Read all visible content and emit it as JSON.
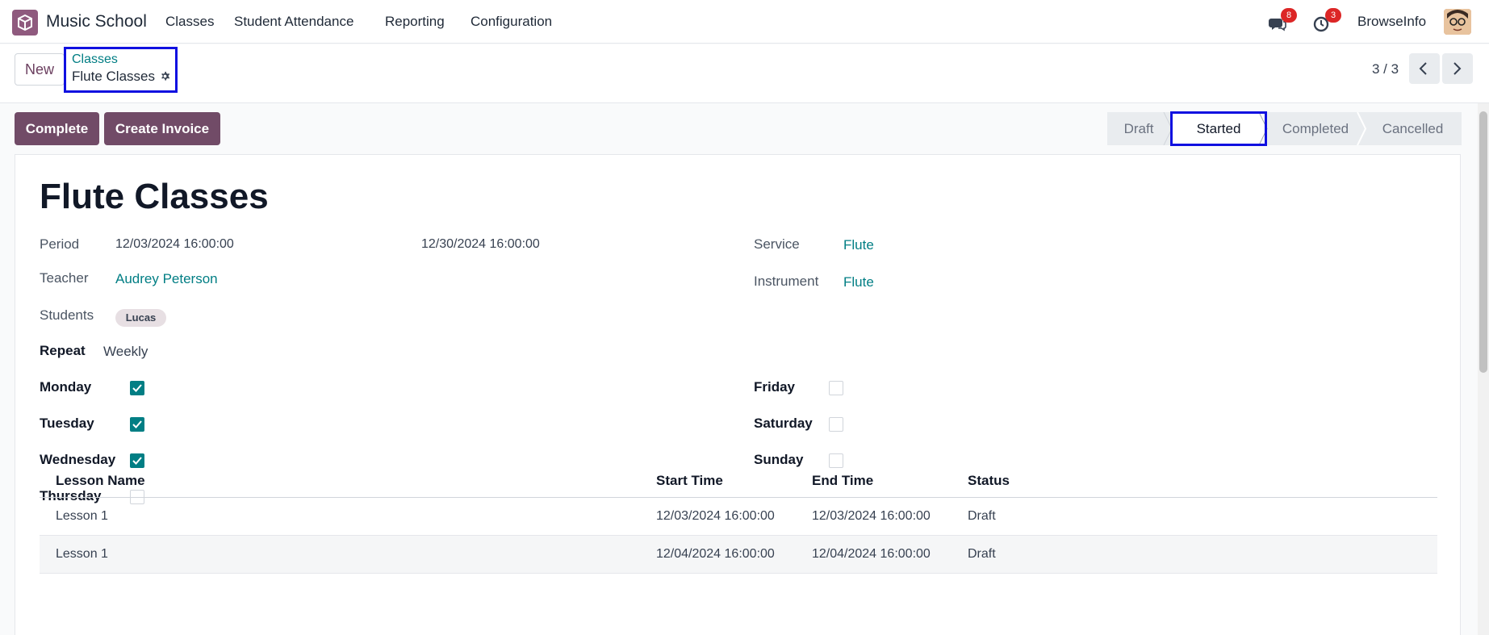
{
  "navbar": {
    "app_name": "Music School",
    "menu": [
      "Classes",
      "Student Attendance",
      "Reporting",
      "Configuration"
    ],
    "messages_count": "8",
    "activities_count": "3",
    "company": "BrowseInfo"
  },
  "control": {
    "new_label": "New",
    "breadcrumb_parent": "Classes",
    "breadcrumb_current": "Flute Classes",
    "pager": "3 / 3"
  },
  "actions": {
    "complete": "Complete",
    "create_invoice": "Create Invoice"
  },
  "status": {
    "stages": [
      "Draft",
      "Started",
      "Completed",
      "Cancelled"
    ],
    "active": "Started"
  },
  "record": {
    "title": "Flute Classes",
    "period_label": "Period",
    "period_start": "12/03/2024 16:00:00",
    "period_end": "12/30/2024 16:00:00",
    "teacher_label": "Teacher",
    "teacher": "Audrey Peterson",
    "students_label": "Students",
    "student_tag": "Lucas",
    "service_label": "Service",
    "service": "Flute",
    "instrument_label": "Instrument",
    "instrument": "Flute",
    "repeat_label": "Repeat",
    "repeat": "Weekly"
  },
  "days": {
    "monday": "Monday",
    "tuesday": "Tuesday",
    "wednesday": "Wednesday",
    "thursday": "Thursday",
    "friday": "Friday",
    "saturday": "Saturday",
    "sunday": "Sunday",
    "checked": {
      "monday": true,
      "tuesday": true,
      "wednesday": true,
      "thursday": false,
      "friday": false,
      "saturday": false,
      "sunday": false
    }
  },
  "lessons": {
    "headers": [
      "Lesson Name",
      "Start Time",
      "End Time",
      "Status"
    ],
    "rows": [
      [
        "Lesson 1",
        "12/03/2024 16:00:00",
        "12/03/2024 16:00:00",
        "Draft"
      ],
      [
        "Lesson 1",
        "12/04/2024 16:00:00",
        "12/04/2024 16:00:00",
        "Draft"
      ]
    ]
  },
  "colors": {
    "brand": "#714b67",
    "link": "#017e84",
    "highlight_border": "#1010e0"
  }
}
